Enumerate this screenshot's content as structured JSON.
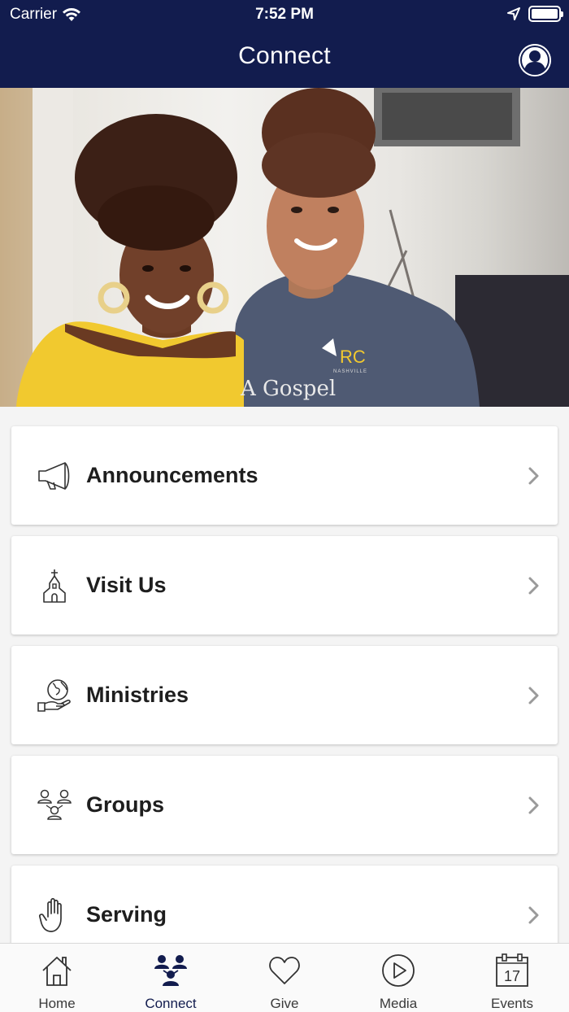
{
  "status_bar": {
    "carrier": "Carrier",
    "time": "7:52 PM"
  },
  "nav": {
    "title": "Connect"
  },
  "menu": {
    "items": [
      {
        "label": "Announcements",
        "icon": "megaphone-icon"
      },
      {
        "label": "Visit Us",
        "icon": "church-icon"
      },
      {
        "label": "Ministries",
        "icon": "globe-hand-icon"
      },
      {
        "label": "Groups",
        "icon": "groups-icon"
      },
      {
        "label": "Serving",
        "icon": "raised-hand-icon"
      }
    ]
  },
  "hero_image": {
    "shirt_text": "A Gospel",
    "logo_text": "RC",
    "logo_subtext": "NASHVILLE"
  },
  "tabs": [
    {
      "label": "Home",
      "icon": "home-icon",
      "active": false
    },
    {
      "label": "Connect",
      "icon": "connect-icon",
      "active": true
    },
    {
      "label": "Give",
      "icon": "heart-icon",
      "active": false
    },
    {
      "label": "Media",
      "icon": "play-icon",
      "active": false
    },
    {
      "label": "Events",
      "icon": "calendar-icon",
      "active": false,
      "date": "17"
    }
  ],
  "colors": {
    "nav_background": "#121c4e",
    "page_background": "#f4f4f4",
    "card_background": "#ffffff",
    "active_tab": "#121c4e"
  }
}
